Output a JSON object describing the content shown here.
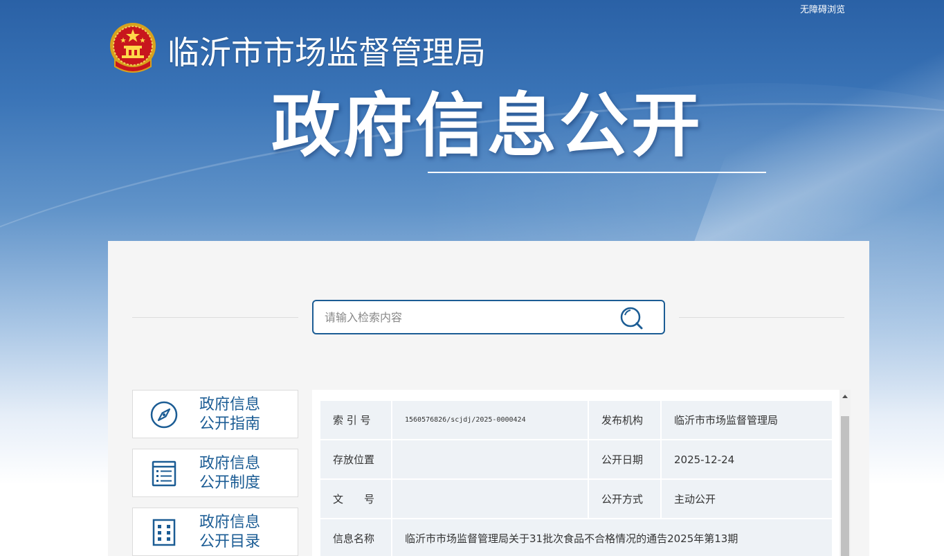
{
  "header": {
    "accessibility_label": "无障碍浏览",
    "site_title": "临沂市市场监督管理局",
    "hero_title": "政府信息公开",
    "emblem_icon": "national-emblem-icon"
  },
  "search": {
    "placeholder": "请输入检索内容",
    "value": "",
    "icon": "search-icon"
  },
  "sidebar": {
    "items": [
      {
        "line1": "政府信息",
        "line2": "公开指南",
        "icon": "compass-icon"
      },
      {
        "line1": "政府信息",
        "line2": "公开制度",
        "icon": "document-list-icon"
      },
      {
        "line1": "政府信息",
        "line2": "公开目录",
        "icon": "catalog-grid-icon"
      }
    ]
  },
  "detail": {
    "rows": [
      {
        "k1": "索 引 号",
        "v1": "1560576826/scjdj/2025-0000424",
        "k2": "发布机构",
        "v2": "临沂市市场监督管理局"
      },
      {
        "k1": "存放位置",
        "v1": "",
        "k2": "公开日期",
        "v2": "2025-12-24"
      },
      {
        "k1": "文　　号",
        "v1": "",
        "k2": "公开方式",
        "v2": "主动公开"
      }
    ],
    "info_name_label": "信息名称",
    "info_name_value": "临沂市市场监督管理局关于31批次食品不合格情况的通告2025年第13期"
  },
  "colors": {
    "brand_blue": "#1b5c94",
    "banner_top": "#2a61a6",
    "panel_bg": "#f5f5f5",
    "cell_bg": "#eef2f6"
  }
}
